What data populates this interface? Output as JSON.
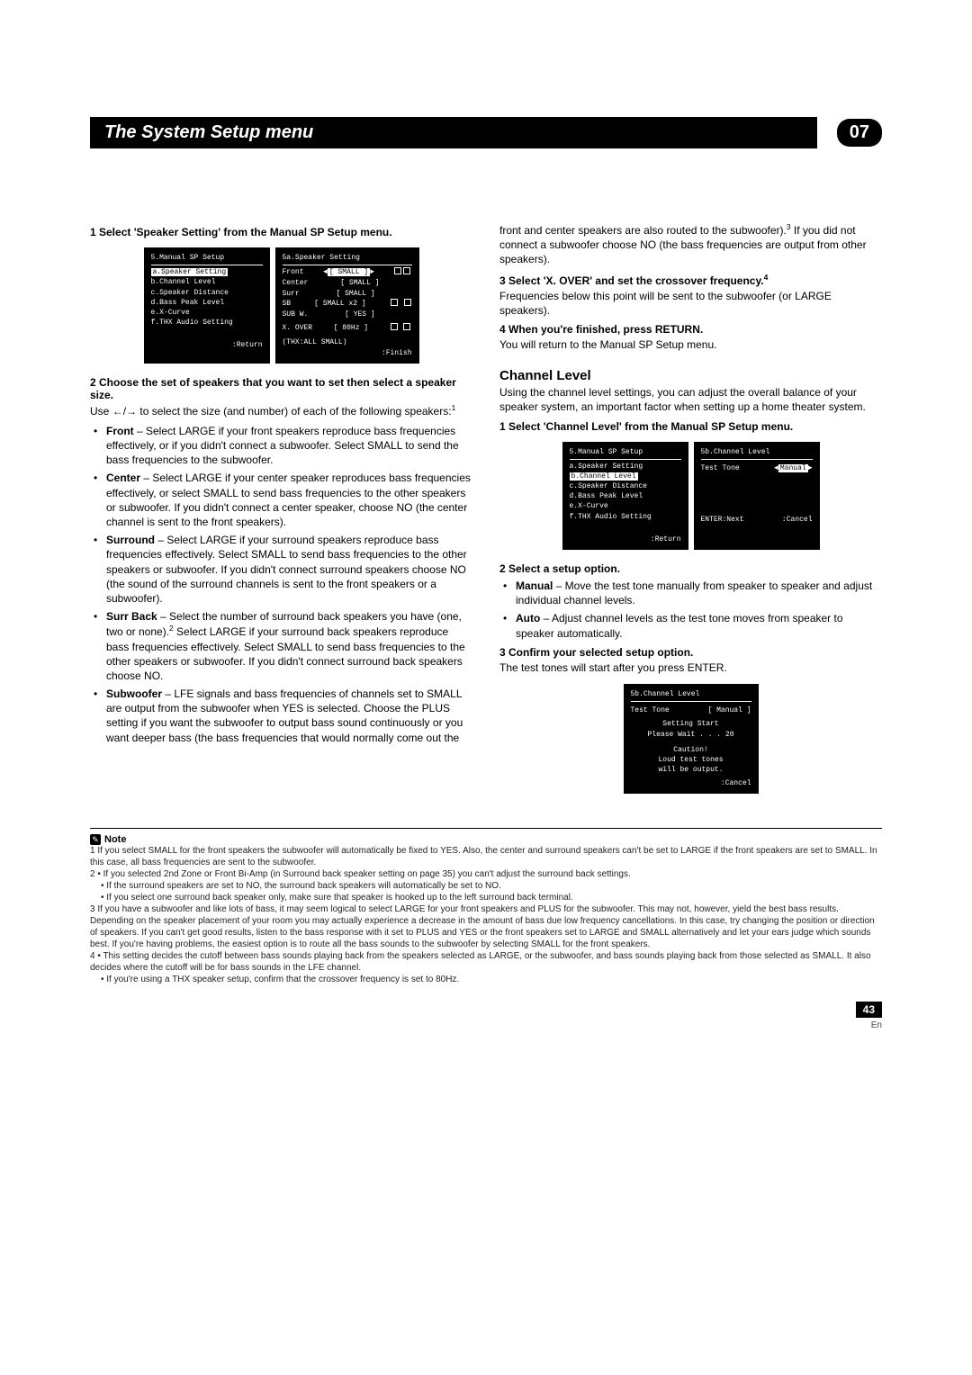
{
  "header": {
    "title": "The System Setup menu",
    "chapter": "07"
  },
  "left": {
    "step1": "1   Select 'Speaker Setting' from the Manual SP Setup menu.",
    "osd_a": {
      "title": "5.Manual  SP  Setup",
      "items": [
        "a.Speaker  Setting",
        "b.Channel  Level",
        "c.Speaker  Distance",
        "d.Bass  Peak  Level",
        "e.X-Curve",
        "f.THX  Audio  Setting"
      ],
      "foot_r": ":Return"
    },
    "osd_b": {
      "title": "5a.Speaker  Setting",
      "rows": [
        [
          "Front",
          "[ SMALL ]"
        ],
        [
          "Center",
          "[ SMALL ]"
        ],
        [
          "Surr",
          "[ SMALL ]"
        ],
        [
          "SB",
          "[ SMALL x2 ]"
        ],
        [
          "SUB W.",
          "[    YES   ]"
        ],
        [
          "X. OVER",
          "[   80Hz  ]"
        ]
      ],
      "thx": "(THX:ALL  SMALL)",
      "foot_r": ":Finish"
    },
    "step2": "2   Choose the set of speakers that you want to set then select a speaker size.",
    "useArrows_pre": "Use ",
    "useArrows_post": " to select the size (and number) of each of the following speakers:",
    "sup1": "1",
    "front_b": "Front",
    "front": " – Select LARGE if your front speakers reproduce bass frequencies effectively, or if you didn't connect a subwoofer. Select SMALL to send the bass frequencies to the subwoofer.",
    "center_b": "Center",
    "center": " – Select LARGE if your center speaker reproduces bass frequencies effectively, or select SMALL to send bass frequencies to the other speakers or subwoofer. If you didn't connect a center speaker, choose NO (the center channel is sent to the front speakers).",
    "surround_b": "Surround",
    "surround": " – Select LARGE if your surround speakers reproduce bass frequencies effectively. Select SMALL to send bass frequencies to the other speakers or subwoofer. If you didn't connect surround speakers choose NO (the sound of the surround channels is sent to the front speakers or a subwoofer).",
    "surrback_b": "Surr Back",
    "surrback_a": " – Select the number of surround back speakers you have (one, two or none).",
    "surrback_sup": "2",
    "surrback_c": " Select LARGE if your surround back speakers reproduce bass frequencies effectively. Select SMALL to send bass frequencies to the other speakers or subwoofer. If you didn't connect surround back speakers choose NO.",
    "sub_b": "Subwoofer",
    "sub": " – LFE signals and bass frequencies of channels set to SMALL are output from the subwoofer when YES is selected. Choose the PLUS setting if you want the subwoofer to output bass sound continuously or you want deeper bass (the bass frequencies that would normally come out the"
  },
  "right": {
    "cont_a": "front and center speakers are also routed to the subwoofer).",
    "cont_sup": "3",
    "cont_b": " If you did not connect a subwoofer choose NO (the bass frequencies are output from other speakers).",
    "step3_a": "3   Select 'X. OVER' and set the crossover frequency.",
    "step3_sup": "4",
    "step3_body": "Frequencies below this point will be sent to the subwoofer (or LARGE speakers).",
    "step4": "4   When you're finished, press RETURN.",
    "step4_body": "You will return to the Manual SP Setup menu.",
    "ch_head": "Channel Level",
    "ch_intro": "Using the channel level settings, you can adjust the overall balance of your speaker system, an important factor when setting up a home theater system.",
    "ch_step1": "1   Select 'Channel Level' from the Manual SP Setup menu.",
    "osd_c": {
      "title": "5.Manual  SP  Setup",
      "items": [
        "a.Speaker  Setting",
        "b.Channel  Level",
        "c.Speaker  Distance",
        "d.Bass  Peak  Level",
        "e.X-Curve",
        "f.THX  Audio  Setting"
      ],
      "foot_r": ":Return"
    },
    "osd_d": {
      "title": "5b.Channel  Level",
      "row_l": "Test  Tone",
      "row_r": "Manual",
      "foot_l": "ENTER:Next",
      "foot_r": ":Cancel"
    },
    "ch_step2": "2   Select a setup option.",
    "manual_b": "Manual",
    "manual": " – Move the test tone manually from speaker to speaker and adjust individual channel levels.",
    "auto_b": "Auto",
    "auto": " – Adjust channel levels as the test tone moves from speaker to speaker automatically.",
    "ch_step3": "3   Confirm your selected setup option.",
    "ch_step3_body": "The test tones will start after you press ENTER.",
    "osd_e": {
      "title": "5b.Channel  Level",
      "row_l": "Test  Tone",
      "row_r": "[ Manual ]",
      "l1": "Setting  Start",
      "l2": "Please  Wait . . .      20",
      "l3": "Caution!",
      "l4": "Loud  test  tones",
      "l5": "will  be  output.",
      "foot_r": ":Cancel"
    }
  },
  "notes": {
    "label": "Note",
    "n1": "1  If you select SMALL for the front speakers the subwoofer will automatically be fixed to YES. Also, the center and surround speakers can't be set to LARGE if the front speakers are set to SMALL. In this case, all bass frequencies are sent to the subwoofer.",
    "n2a": "2 • If you selected 2nd Zone or Front Bi-Amp (in Surround back speaker setting on page 35) you can't adjust the surround back settings.",
    "n2b": "• If the surround speakers are set to NO, the surround back speakers will automatically be set to NO.",
    "n2c": "• If you select one surround back speaker only, make sure that speaker is hooked up to the left surround back terminal.",
    "n3": "3  If you have a subwoofer and like lots of bass, it may seem logical to select LARGE for your front speakers and PLUS for the subwoofer. This may not, however, yield the best bass results. Depending on the speaker placement of your room you may actually experience a decrease in the amount of bass due low frequency cancellations. In this case, try changing the position or direction of speakers. If you can't get good results, listen to the bass response with it set to PLUS and YES or the front speakers set to LARGE and SMALL alternatively and let your ears judge which sounds best. If you're having problems, the easiest option is to route all the bass sounds to the subwoofer by selecting SMALL for the front speakers.",
    "n4a": "4 • This setting decides the cutoff between bass sounds playing back from the speakers selected as LARGE, or the subwoofer, and bass sounds playing back from those selected as SMALL. It also decides where the cutoff will be for bass sounds in the LFE channel.",
    "n4b": "• If you're using a THX speaker setup, confirm that the crossover frequency is set to 80Hz."
  },
  "footer": {
    "page": "43",
    "lang": "En"
  }
}
